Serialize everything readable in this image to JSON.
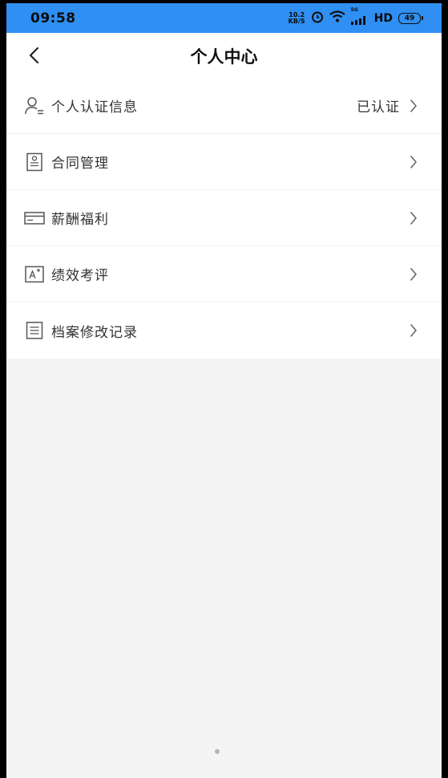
{
  "status_bar": {
    "time": "09:58",
    "net_speed_value": "10.2",
    "net_speed_unit": "KB/S",
    "signal_tag": "5G",
    "hd_label": "HD",
    "battery": "49"
  },
  "header": {
    "title": "个人中心"
  },
  "menu": {
    "items": [
      {
        "label": "个人认证信息",
        "value": "已认证",
        "icon": "person-id-icon"
      },
      {
        "label": "合同管理",
        "value": "",
        "icon": "contract-icon"
      },
      {
        "label": "薪酬福利",
        "value": "",
        "icon": "card-icon"
      },
      {
        "label": "绩效考评",
        "value": "",
        "icon": "grade-a-plus-icon"
      },
      {
        "label": "档案修改记录",
        "value": "",
        "icon": "record-list-icon"
      }
    ]
  },
  "colors": {
    "status_bar_bg": "#2f8ff2",
    "page_bg": "#f4f4f4",
    "card_bg": "#ffffff",
    "text_primary": "#333333"
  }
}
